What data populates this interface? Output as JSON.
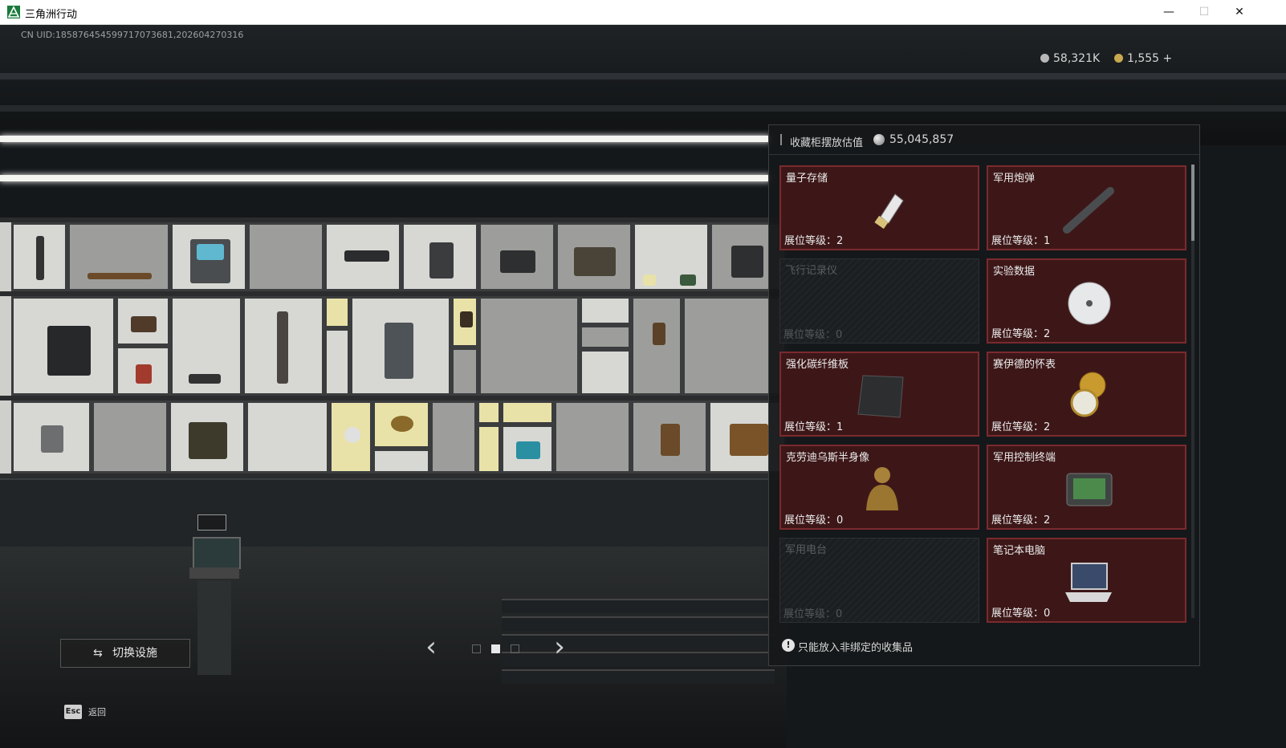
{
  "window": {
    "title": "三角洲行动",
    "min": "—",
    "max": "☐",
    "close": "✕"
  },
  "uid": "CN UID:185876454599717073681,202604270316",
  "currencies": [
    {
      "value": "58,321K",
      "color": "#b8b8b8"
    },
    {
      "value": "1,555 +",
      "color": "#c9a950"
    }
  ],
  "panel": {
    "title": "收藏柜摆放估值",
    "total_value": "55,045,857",
    "items": [
      {
        "name": "量子存储",
        "level": "展位等级：2",
        "locked": false
      },
      {
        "name": "军用炮弹",
        "level": "展位等级：1",
        "locked": false
      },
      {
        "name": "飞行记录仪",
        "level": "展位等级：0",
        "locked": true
      },
      {
        "name": "实验数据",
        "level": "展位等级：2",
        "locked": false
      },
      {
        "name": "强化碳纤维板",
        "level": "展位等级：1",
        "locked": false
      },
      {
        "name": "赛伊德的怀表",
        "level": "展位等级：2",
        "locked": false
      },
      {
        "name": "克劳迪乌斯半身像",
        "level": "展位等级：0",
        "locked": false
      },
      {
        "name": "军用控制终端",
        "level": "展位等级：2",
        "locked": false
      },
      {
        "name": "军用电台",
        "level": "展位等级：0",
        "locked": true
      },
      {
        "name": "笔记本电脑",
        "level": "展位等级：0",
        "locked": false
      }
    ],
    "footer": "只能放入非绑定的收集品"
  },
  "controls": {
    "switch_facility": "切换设施",
    "prev": "‹",
    "next": "›",
    "esc_key": "Esc",
    "esc_label": "返回"
  }
}
